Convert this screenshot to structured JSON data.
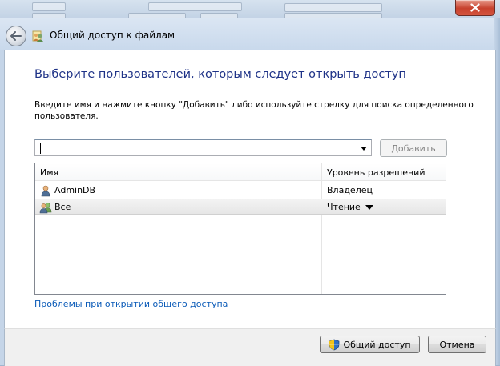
{
  "window": {
    "title": "Общий доступ к файлам"
  },
  "main": {
    "heading": "Выберите пользователей, которым следует открыть доступ",
    "description": "Введите имя и нажмите кнопку \"Добавить\" либо используйте стрелку для поиска определенного пользователя.",
    "name_input": {
      "value": "",
      "placeholder": ""
    },
    "add_button": "Добавить",
    "table": {
      "columns": [
        "Имя",
        "Уровень разрешений"
      ],
      "rows": [
        {
          "name": "AdminDB",
          "permission": "Владелец",
          "icon": "user-icon"
        },
        {
          "name": "Все",
          "permission": "Чтение",
          "icon": "users-group-icon"
        }
      ]
    },
    "help_link": "Проблемы при открытии общего доступа"
  },
  "footer": {
    "share_button": "Общий доступ",
    "cancel_button": "Отмена"
  }
}
